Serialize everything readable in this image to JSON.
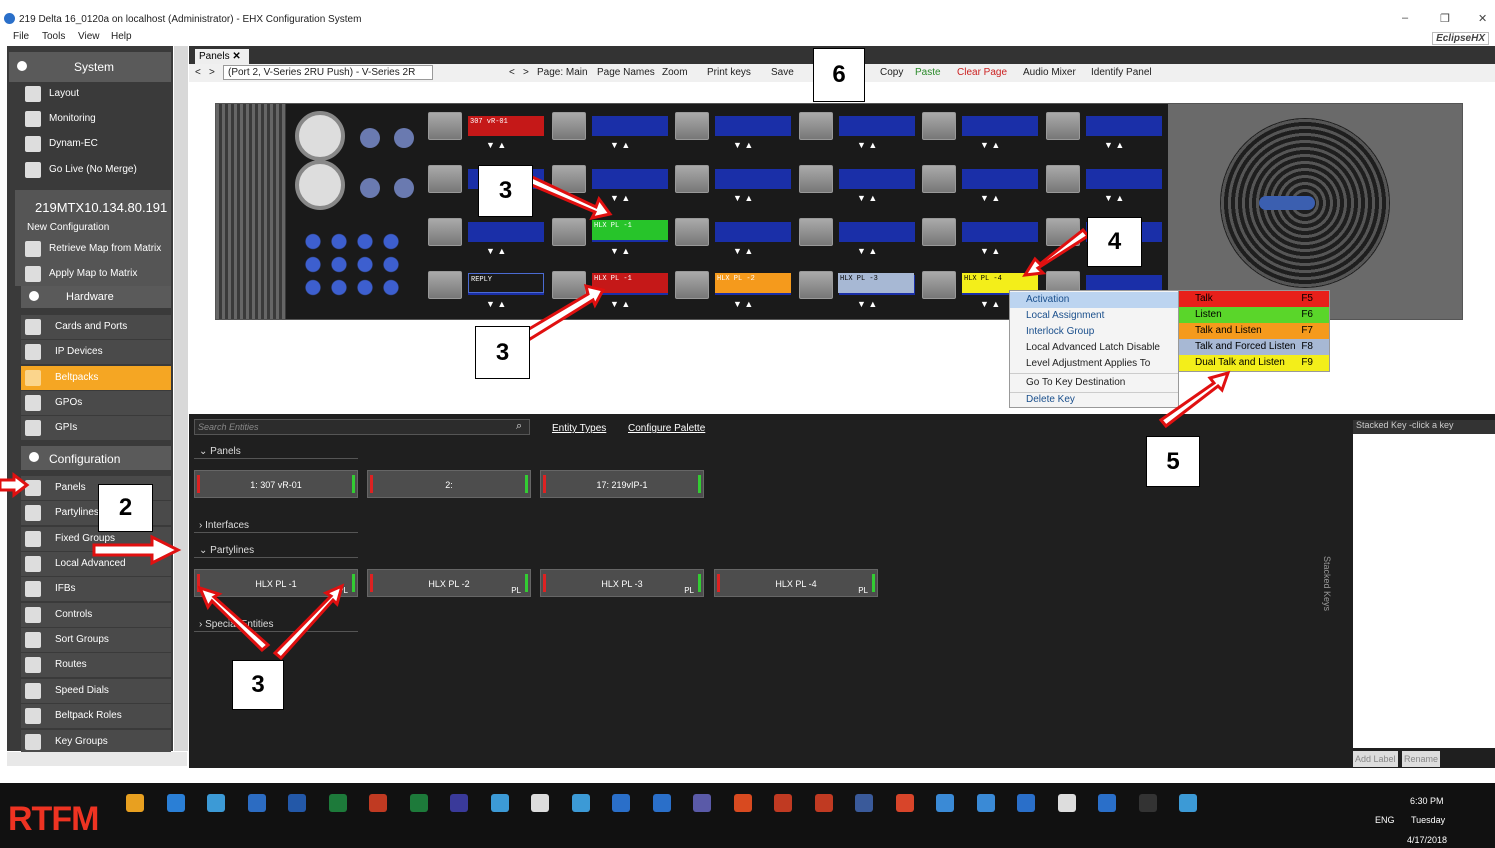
{
  "window": {
    "title": "219 Delta 16_0120a on localhost (Administrator) - EHX Configuration System",
    "brand": "EclipseHX"
  },
  "menu": [
    "File",
    "Tools",
    "View",
    "Help"
  ],
  "sidebar": {
    "system": "System",
    "system_items": [
      "Layout",
      "Monitoring",
      "Dynam-EC",
      "Go Live (No Merge)"
    ],
    "host": "219MTX10.134.80.191",
    "config_name": "New Configuration",
    "config_items": [
      "Retrieve Map from Matrix",
      "Apply Map to Matrix"
    ],
    "hardware": "Hardware",
    "hardware_items": [
      "Cards and Ports",
      "IP Devices",
      "Beltpacks",
      "GPOs",
      "GPIs"
    ],
    "configuration": "Configuration",
    "configuration_items": [
      "Panels",
      "Partylines",
      "Fixed Groups",
      "Local Advanced",
      "IFBs",
      "Controls",
      "Sort Groups",
      "Routes",
      "Speed Dials",
      "Beltpack Roles",
      "Key Groups"
    ]
  },
  "tabs": {
    "panels": "Panels"
  },
  "toolbar": {
    "port": "(Port 2, V-Series 2RU Push)  -  V-Series 2R",
    "page": "Page: Main",
    "page_names": "Page Names",
    "zoom": "Zoom",
    "print": "Print keys",
    "save": "Save",
    "copy": "Copy",
    "paste": "Paste",
    "clear": "Clear Page",
    "mixer": "Audio Mixer",
    "identify": "Identify Panel"
  },
  "panel_keys": {
    "row1_first": "307 vR-01",
    "row3_green": "HLX PL -1",
    "reply": "REPLY",
    "red": "HLX PL -1",
    "orange": "HLX PL -2",
    "gray": "HLX PL -3",
    "yellow": "HLX PL -4"
  },
  "context_menu": [
    "Activation",
    "Local Assignment",
    "Interlock Group",
    "Local Advanced Latch Disable",
    "Level Adjustment Applies To",
    "Go To Key Destination",
    "Delete Key"
  ],
  "submenu": [
    {
      "label": "Talk",
      "key": "F5",
      "color": "#e8201a"
    },
    {
      "label": "Listen",
      "key": "F6",
      "color": "#5ad62a"
    },
    {
      "label": "Talk and Listen",
      "key": "F7",
      "color": "#f59a1c"
    },
    {
      "label": "Talk and Forced Listen",
      "key": "F8",
      "color": "#a7b8d4"
    },
    {
      "label": "Dual Talk and Listen",
      "key": "F9",
      "color": "#f3ee1a"
    }
  ],
  "entities": {
    "search_placeholder": "Search Entities",
    "entity_types": "Entity Types",
    "configure_palette": "Configure Palette",
    "panels_group": "Panels",
    "panels": [
      "1: 307 vR-01",
      "2:",
      "17: 219vIP-1"
    ],
    "interfaces_group": "Interfaces",
    "partylines_group": "Partylines",
    "partylines": [
      "HLX PL -1",
      "HLX PL -2",
      "HLX PL -3",
      "HLX PL -4"
    ],
    "pl_tag": "PL",
    "special_group": "Special Entities"
  },
  "stack": {
    "header": "Stacked Key -click a key",
    "vertical": "Stacked Keys",
    "add_label": "Add Label",
    "rename": "Rename"
  },
  "callouts": [
    "2",
    "3",
    "3",
    "3",
    "4",
    "5",
    "6"
  ],
  "taskbar": {
    "logo": "RTFM",
    "time": "6:30 PM",
    "day": "Tuesday",
    "date": "4/17/2018",
    "lang": "ENG"
  }
}
